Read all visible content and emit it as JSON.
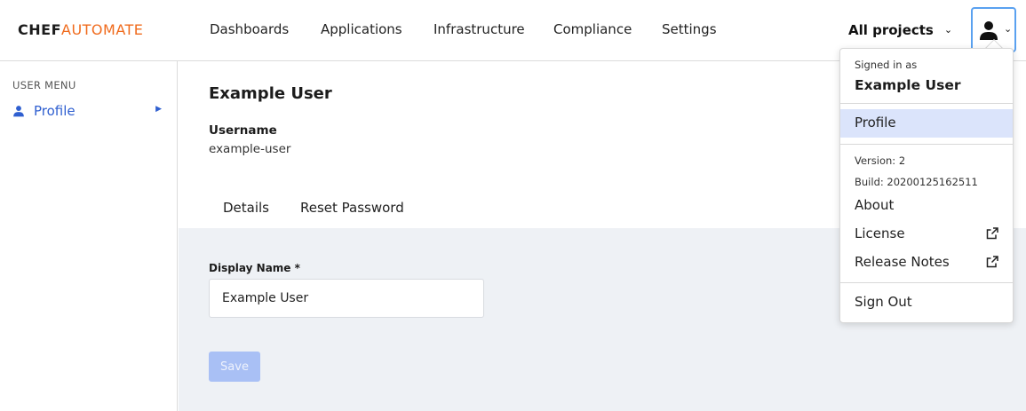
{
  "logo": {
    "chef": "CHEF",
    "automate": "AUTOMATE"
  },
  "nav": [
    "Dashboards",
    "Applications",
    "Infrastructure",
    "Compliance",
    "Settings"
  ],
  "projects": {
    "label": "All projects",
    "chevron": "⌄"
  },
  "user_button": {
    "icon": "person-icon",
    "chevron": "⌄"
  },
  "sidebar": {
    "heading": "USER MENU",
    "items": [
      {
        "label": "Profile",
        "icon": "person-icon",
        "arrow": "▶"
      }
    ]
  },
  "main": {
    "title": "Example User",
    "username_label": "Username",
    "username_value": "example-user",
    "tabs": [
      {
        "label": "Details",
        "active": true
      },
      {
        "label": "Reset Password",
        "active": false
      }
    ],
    "form": {
      "display_name_label": "Display Name *",
      "display_name_value": "Example User",
      "save_label": "Save"
    }
  },
  "user_menu": {
    "signed_in_as": "Signed in as",
    "name": "Example User",
    "profile": "Profile",
    "version": "Version: 2",
    "build": "Build: 20200125162511",
    "about": "About",
    "license": "License",
    "release_notes": "Release Notes",
    "sign_out": "Sign Out"
  },
  "colors": {
    "accent": "#2f5fd0",
    "brand_orange": "#f06b1d",
    "panel_bg": "#eef1f5",
    "active_item_bg": "#dbe4fb",
    "disabled_button": "#a9c0f5"
  }
}
